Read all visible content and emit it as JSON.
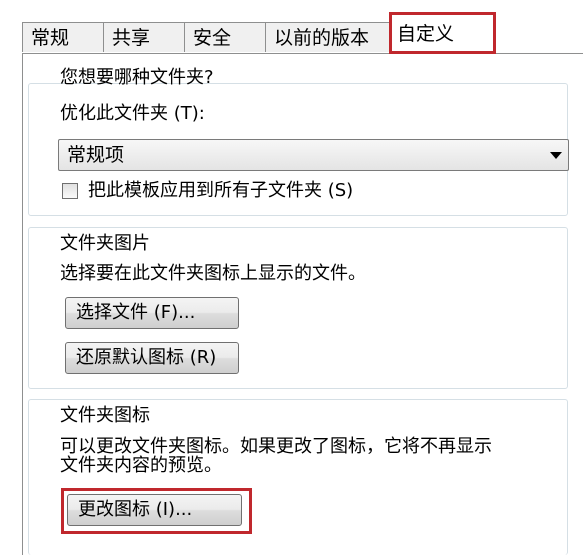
{
  "tabs": [
    {
      "label": "常规"
    },
    {
      "label": "共享"
    },
    {
      "label": "安全"
    },
    {
      "label": "以前的版本"
    },
    {
      "label": "自定义"
    }
  ],
  "active_tab": "自定义",
  "accent_color": "#c0282d",
  "folder_type": {
    "question": "您想要哪种文件夹?",
    "optimize_label": "优化此文件夹 (T):",
    "selected_option": "常规项",
    "apply_subfolders_label": "把此模板应用到所有子文件夹 (S)",
    "apply_subfolders_checked": false
  },
  "folder_pictures": {
    "title": "文件夹图片",
    "description": "选择要在此文件夹图标上显示的文件。",
    "choose_file_button": "选择文件 (F)...",
    "restore_default_button": "还原默认图标 (R)"
  },
  "folder_icons": {
    "title": "文件夹图标",
    "description_line1": "可以更改文件夹图标。如果更改了图标，它将不再显示",
    "description_line2": "文件夹内容的预览。",
    "change_icon_button": "更改图标 (I)..."
  }
}
